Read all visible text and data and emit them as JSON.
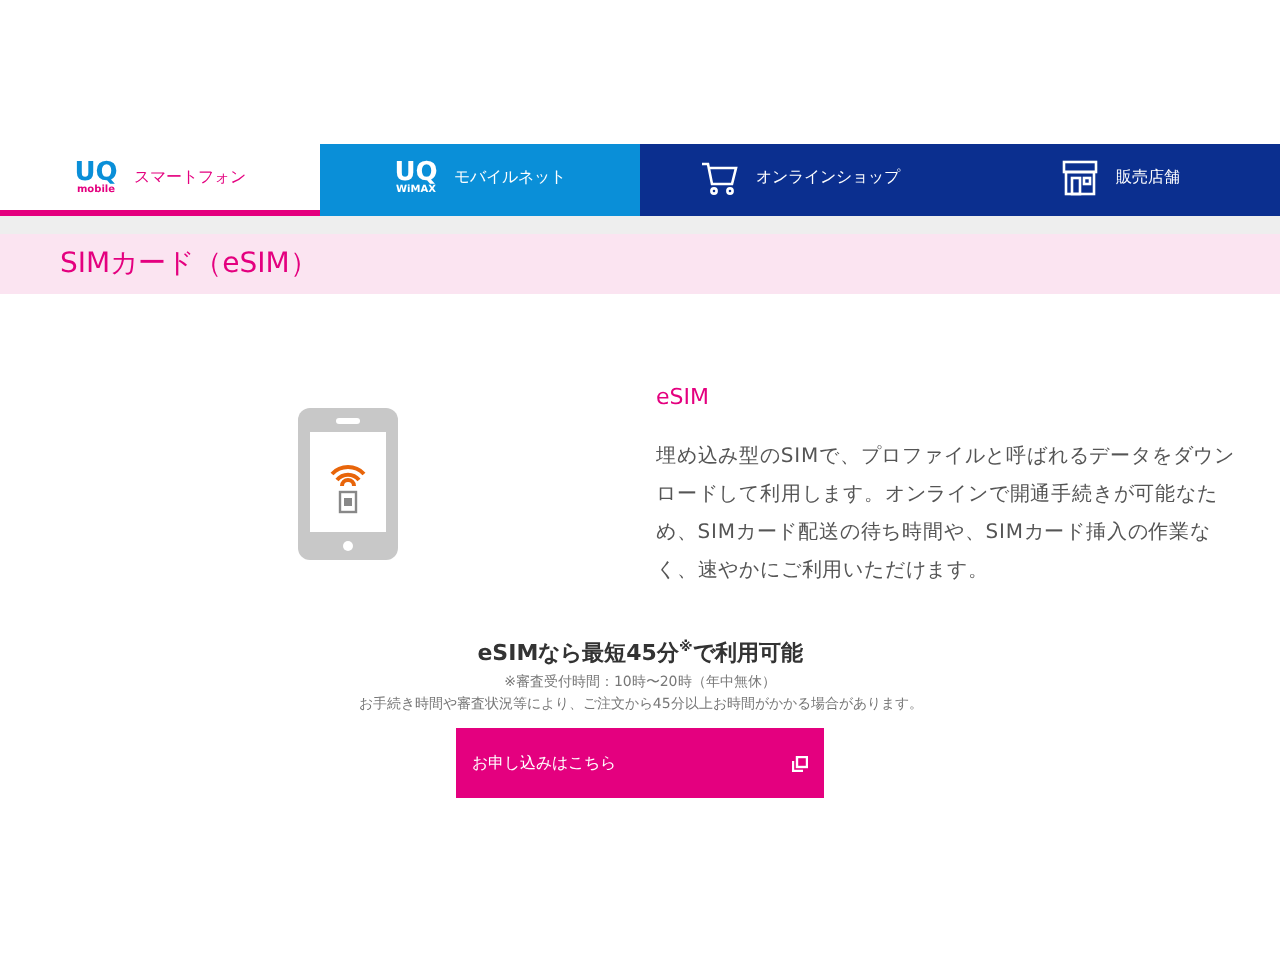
{
  "nav": {
    "tabs": [
      {
        "kind": "uq",
        "logo_top": "UQ",
        "logo_bottom": "mobile",
        "label": "スマートフォン",
        "selected": true
      },
      {
        "kind": "uq",
        "logo_top": "UQ",
        "logo_bottom": "WiMAX",
        "label": "モバイルネット",
        "selected": false
      },
      {
        "kind": "cart",
        "label": "オンラインショップ",
        "selected": false
      },
      {
        "kind": "store",
        "label": "販売店舗",
        "selected": false
      }
    ]
  },
  "page_title": "SIMカード（eSIM）",
  "feature": {
    "title": "eSIM",
    "body": "埋め込み型のSIMで、プロファイルと呼ばれるデータをダウンロードして利用します。オンラインで開通手続きが可能なため、SIMカード配送の待ち時間や、SIMカード挿入の作業なく、速やかにご利用いただけます。"
  },
  "promo": {
    "headline": "eSIMなら最短45分$^{※}$で利用可能",
    "note": "※審査受付時間：10時〜20時（年中無休）",
    "disclaimer": "お手続き時間や審査状況等により、ご注文から45分以上お時間がかかる場合があります。",
    "button": "お申し込みはこちら"
  }
}
